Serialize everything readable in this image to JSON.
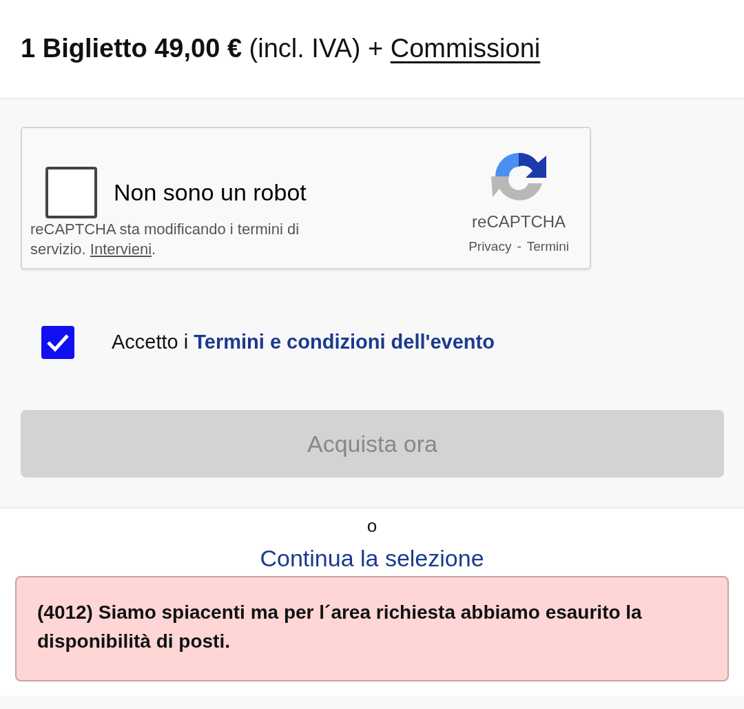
{
  "price_line": {
    "text": "**1 Biglietto 49,00 €** (incl. IVA) + ",
    "link": "Commissioni"
  },
  "recaptcha": {
    "checked": false,
    "label": "Non sono un robot",
    "notice": "reCAPTCHA sta modificando i termini di servizio. ",
    "notice_link": "Intervieni",
    "notice_end": ".",
    "brand": "reCAPTCHA",
    "privacy": "Privacy",
    "separator": "-",
    "terms": "Termini"
  },
  "terms_checkbox": {
    "checked": true,
    "text": "Accetto i ",
    "link": "Termini e condizioni dell'evento"
  },
  "buy_button": {
    "label": "Acquista ora",
    "disabled": true
  },
  "or_text": "o",
  "continue_link": "Continua la selezione",
  "error_toast": {
    "text": "(4012) Siamo spiacenti ma per l´area richiesta abbiamo esaurito la disponibilità di posti."
  }
}
